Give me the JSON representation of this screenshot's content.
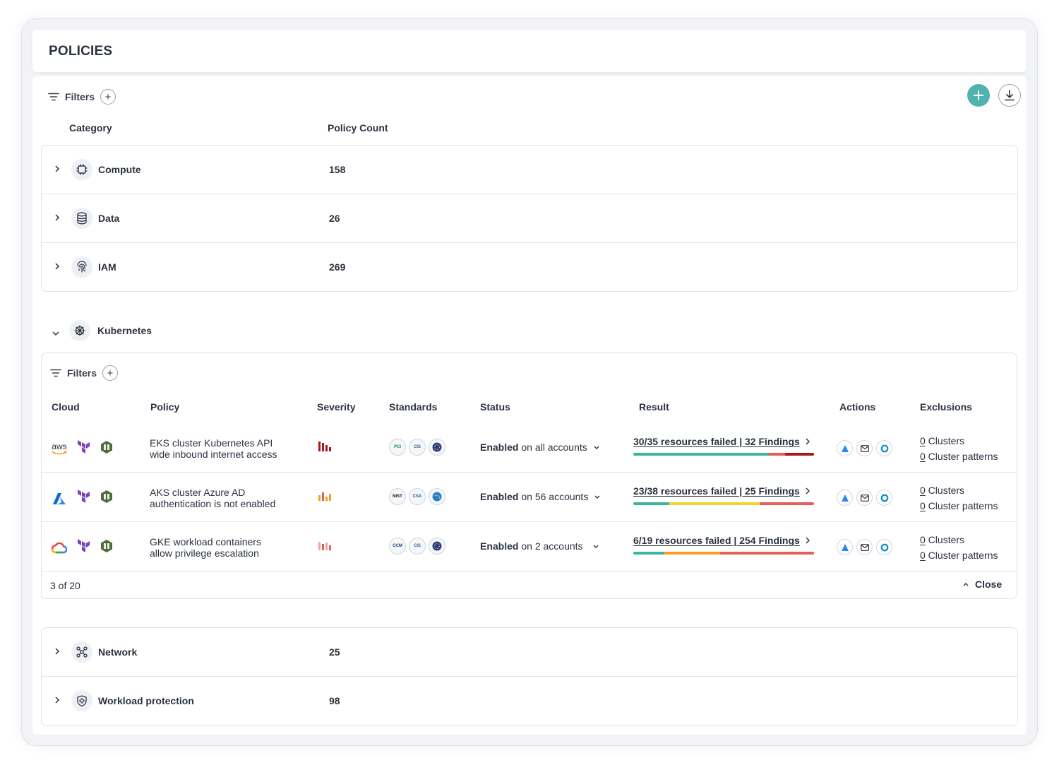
{
  "page": {
    "title": "POLICIES"
  },
  "toolbar": {
    "filters_label": "Filters",
    "add_icon": "plus-icon",
    "download_icon": "download-icon"
  },
  "columns": {
    "category": "Category",
    "policy_count": "Policy Count"
  },
  "categories_top": [
    {
      "name": "Compute",
      "count": "158",
      "icon": "cpu-icon"
    },
    {
      "name": "Data",
      "count": "26",
      "icon": "database-icon"
    },
    {
      "name": "IAM",
      "count": "269",
      "icon": "fingerprint-icon"
    }
  ],
  "kubernetes": {
    "name": "Kubernetes",
    "icon": "helm-wheel-icon",
    "filters_label": "Filters",
    "headers": {
      "cloud": "Cloud",
      "policy": "Policy",
      "severity": "Severity",
      "standards": "Standards",
      "status": "Status",
      "result": "Result",
      "actions": "Actions",
      "exclusions": "Exclusions"
    },
    "rows": [
      {
        "clouds": [
          "aws-icon",
          "terraform-icon",
          "opa-icon"
        ],
        "aws_text": "aws",
        "policy_line1": "EKS cluster Kubernetes API",
        "policy_line2": "wide inbound internet access",
        "severity": "critical",
        "standards": [
          "PCI",
          "CIS",
          "EU"
        ],
        "status_bold": "Enabled",
        "status_rest": " on all accounts",
        "result": "30/35 resources failed | 32 Findings",
        "bar": [
          {
            "color": "#3bb59e",
            "pct": 75
          },
          {
            "color": "#e85d57",
            "pct": 9
          },
          {
            "color": "#a8191b",
            "pct": 16
          }
        ],
        "excl_clusters_num": "0",
        "excl_clusters_label": " Clusters",
        "excl_patterns_num": "0",
        "excl_patterns_label": " Cluster patterns"
      },
      {
        "clouds": [
          "azure-icon",
          "terraform-icon",
          "opa-icon"
        ],
        "policy_line1": "AKS cluster Azure AD",
        "policy_line2": "authentication is not enabled",
        "severity": "medium",
        "standards": [
          "NIST",
          "CSA",
          "GLOBE"
        ],
        "status_bold": "Enabled",
        "status_rest": " on 56 accounts",
        "result": "23/38 resources failed | 25 Findings",
        "bar": [
          {
            "color": "#3bb59e",
            "pct": 20
          },
          {
            "color": "#f6d231",
            "pct": 50
          },
          {
            "color": "#e85d57",
            "pct": 30
          }
        ],
        "excl_clusters_num": "0",
        "excl_clusters_label": " Clusters",
        "excl_patterns_num": "0",
        "excl_patterns_label": " Cluster patterns"
      },
      {
        "clouds": [
          "gcp-icon",
          "terraform-icon",
          "opa-icon"
        ],
        "policy_line1": "GKE workload containers",
        "policy_line2": "allow privilege escalation",
        "severity": "low",
        "standards": [
          "CCM",
          "CIS",
          "EU"
        ],
        "status_bold": "Enabled",
        "status_rest": " on 2 accounts",
        "result": "6/19 resources failed | 254 Findings",
        "bar": [
          {
            "color": "#3bb59e",
            "pct": 17
          },
          {
            "color": "#f5a21b",
            "pct": 31
          },
          {
            "color": "#e85d57",
            "pct": 52
          }
        ],
        "excl_clusters_num": "0",
        "excl_clusters_label": " Clusters",
        "excl_patterns_num": "0",
        "excl_patterns_label": " Cluster patterns"
      }
    ],
    "pagination": "3 of 20",
    "close_label": "Close"
  },
  "categories_bottom": [
    {
      "name": "Network",
      "count": "25",
      "icon": "network-icon"
    },
    {
      "name": "Workload protection",
      "count": "98",
      "icon": "workload-shield-icon"
    }
  ],
  "colors": {
    "accent": "#52b3ae",
    "text": "#2b3240",
    "border": "#dfe2e8"
  }
}
